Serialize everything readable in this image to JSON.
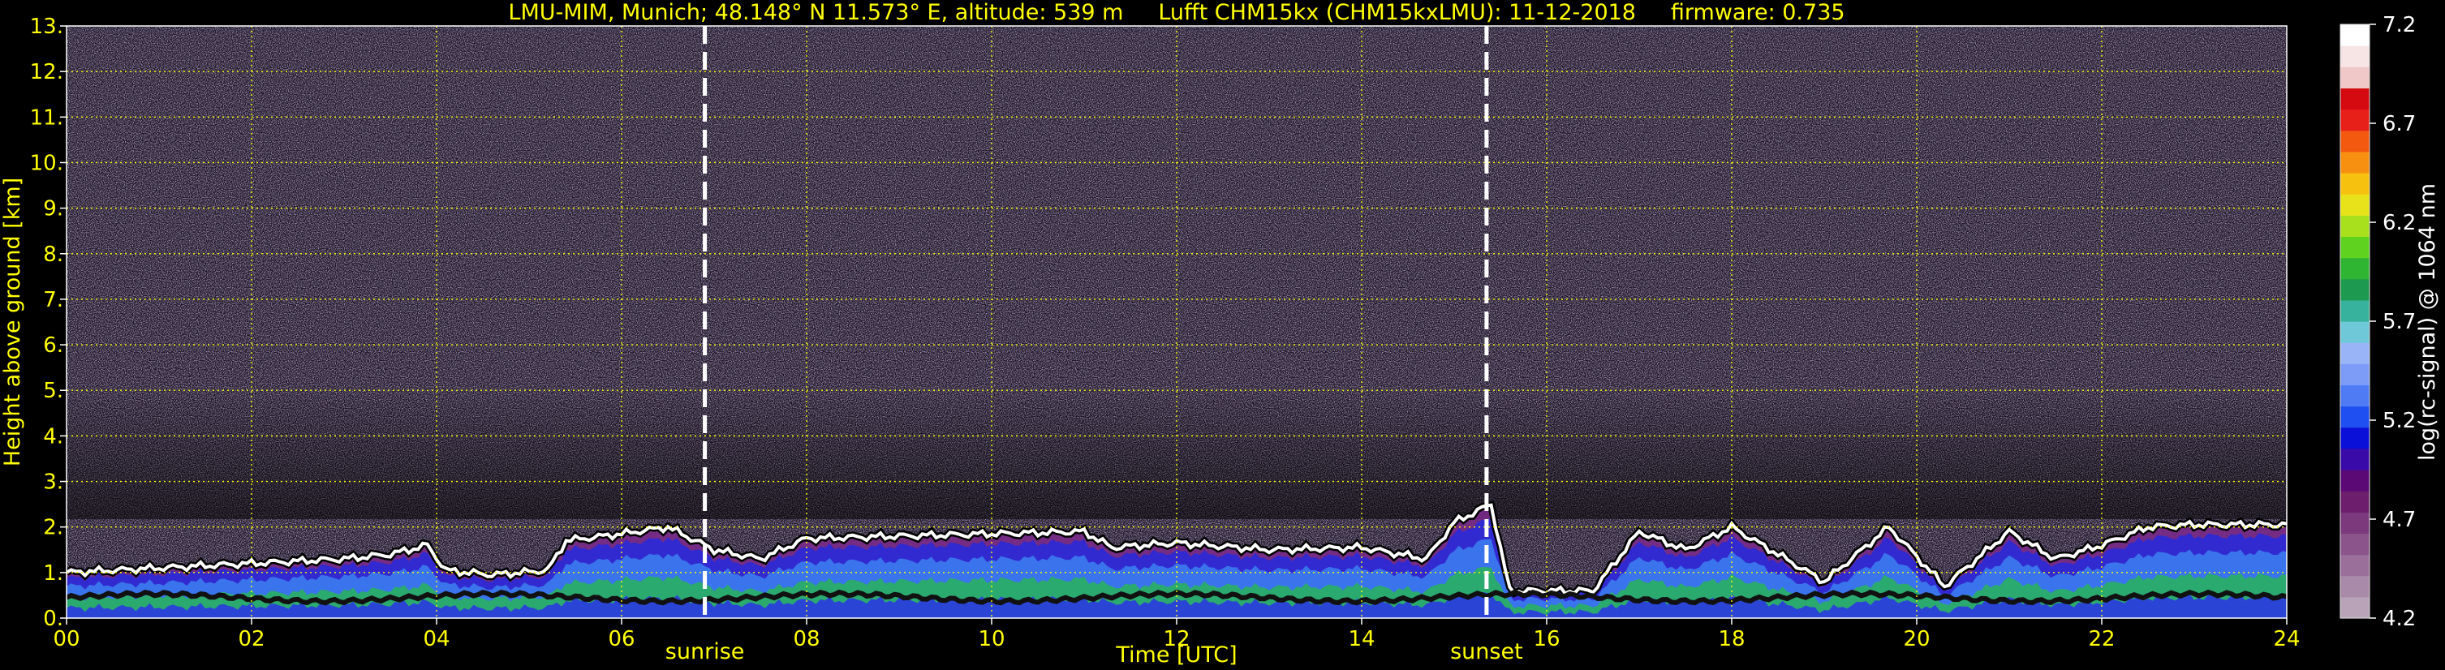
{
  "chart_data": {
    "type": "heatmap",
    "title": "LMU-MIM, Munich; 48.148° N 11.573° E, altitude: 539 m     Lufft CHM15kx (CHM15kxLMU): 11-12-2018     firmware: 0.735",
    "xlabel": "Time [UTC]",
    "ylabel": "Height above ground [km]",
    "xlim": [
      0,
      24
    ],
    "ylim": [
      0,
      13
    ],
    "x_ticks": [
      "00",
      "02",
      "04",
      "06",
      "08",
      "10",
      "12",
      "14",
      "16",
      "18",
      "20",
      "22",
      "24"
    ],
    "y_ticks": [
      "0.",
      "1.",
      "2.",
      "3.",
      "4.",
      "5.",
      "6.",
      "7.",
      "8.",
      "9.",
      "10.",
      "11.",
      "12.",
      "13."
    ],
    "grid": true,
    "events": [
      {
        "label": "sunrise",
        "time": 6.9
      },
      {
        "label": "sunset",
        "time": 15.35
      }
    ],
    "boundary_layer_top_km": [
      [
        0,
        1.0
      ],
      [
        0.5,
        1.05
      ],
      [
        1,
        1.1
      ],
      [
        1.5,
        1.15
      ],
      [
        2,
        1.2
      ],
      [
        2.5,
        1.25
      ],
      [
        3,
        1.3
      ],
      [
        3.5,
        1.4
      ],
      [
        3.9,
        1.6
      ],
      [
        4.1,
        1.05
      ],
      [
        4.6,
        0.95
      ],
      [
        5.2,
        1.05
      ],
      [
        5.4,
        1.7
      ],
      [
        6.0,
        1.85
      ],
      [
        6.5,
        2.0
      ],
      [
        7.0,
        1.5
      ],
      [
        7.5,
        1.3
      ],
      [
        8.0,
        1.75
      ],
      [
        9,
        1.8
      ],
      [
        10,
        1.85
      ],
      [
        11,
        1.9
      ],
      [
        11.3,
        1.55
      ],
      [
        12,
        1.65
      ],
      [
        13,
        1.5
      ],
      [
        14,
        1.55
      ],
      [
        14.7,
        1.3
      ],
      [
        15.0,
        2.1
      ],
      [
        15.4,
        2.5
      ],
      [
        15.6,
        0.6
      ],
      [
        16.5,
        0.6
      ],
      [
        17.0,
        1.9
      ],
      [
        17.5,
        1.5
      ],
      [
        18.0,
        2.0
      ],
      [
        18.5,
        1.4
      ],
      [
        19.0,
        0.8
      ],
      [
        19.7,
        2.0
      ],
      [
        20.3,
        0.7
      ],
      [
        21.0,
        1.9
      ],
      [
        21.5,
        1.3
      ],
      [
        22.0,
        1.6
      ],
      [
        22.5,
        2.0
      ],
      [
        23,
        2.05
      ],
      [
        24,
        2.05
      ]
    ],
    "colorbar": {
      "label": "log(rc-signal) @ 1064 nm",
      "min": 4.2,
      "max": 7.2,
      "ticks": [
        "4.2",
        "4.7",
        "5.2",
        "5.7",
        "6.2",
        "6.7",
        "7.2"
      ],
      "colors": [
        "#b8a3b8",
        "#a98aa9",
        "#9a6f9a",
        "#8b548b",
        "#7c397c",
        "#6d1e6d",
        "#5b0a75",
        "#3a0aa8",
        "#0a10d8",
        "#1f4ff0",
        "#4f7cf5",
        "#7d9cf7",
        "#9ab5f7",
        "#6fc8d8",
        "#37b29c",
        "#1d9a4f",
        "#2fb532",
        "#5fd21f",
        "#a8e01e",
        "#e7e21a",
        "#f7c20f",
        "#f79010",
        "#f35a10",
        "#e8201a",
        "#d40a10",
        "#f0c8c8",
        "#f7e4e4",
        "#ffffff"
      ]
    },
    "colors": {
      "text": "#ffff00",
      "grid": "#ffff00",
      "background": "#000000",
      "noise": "#7b6a93"
    }
  }
}
